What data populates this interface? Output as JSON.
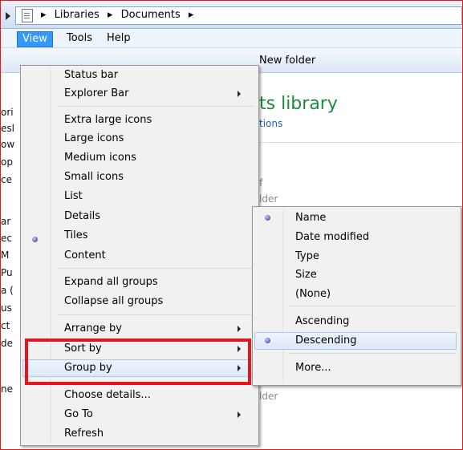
{
  "address_bar": {
    "crumbs": [
      "Libraries",
      "Documents"
    ],
    "separator": "▸"
  },
  "menubar": {
    "view": "View",
    "tools": "Tools",
    "help": "Help"
  },
  "toolbar": {
    "new_folder": "New folder"
  },
  "library": {
    "title": "ts library",
    "link": "tions",
    "col_folder_1": "lder",
    "col_folder_2": "lder",
    "small_f": "f"
  },
  "left_fragments": [
    "ori",
    "esl",
    "ow",
    "op",
    "ce",
    "ar",
    "ec",
    "M",
    "Pu",
    "a (",
    "us",
    "ct",
    "de",
    "ne"
  ],
  "view_menu": {
    "items": {
      "status_bar": "Status bar",
      "explorer_bar": "Explorer Bar",
      "extra_large_icons": "Extra large icons",
      "large_icons": "Large icons",
      "medium_icons": "Medium icons",
      "small_icons": "Small icons",
      "list": "List",
      "details": "Details",
      "tiles": "Tiles",
      "content": "Content",
      "expand_all": "Expand all groups",
      "collapse_all": "Collapse all groups",
      "arrange_by": "Arrange by",
      "sort_by": "Sort by",
      "group_by": "Group by",
      "choose_details": "Choose details...",
      "go_to": "Go To",
      "refresh": "Refresh"
    },
    "selected_view": "Tiles"
  },
  "group_by_submenu": {
    "items": {
      "name": "Name",
      "date_modified": "Date modified",
      "type": "Type",
      "size": "Size",
      "none": "(None)",
      "ascending": "Ascending",
      "descending": "Descending",
      "more": "More..."
    },
    "selected_field": "Name",
    "selected_order": "Descending"
  },
  "colors": {
    "highlight_border": "#e3151d",
    "menu_highlight": "#3399ff",
    "library_title": "#1d8b3a",
    "link": "#1a5fb4"
  }
}
